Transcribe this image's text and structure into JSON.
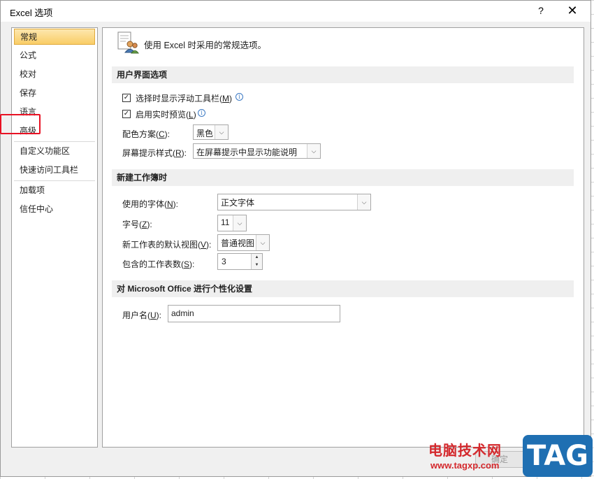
{
  "window": {
    "title": "Excel 选项",
    "help_label": "?",
    "close_label": "✕"
  },
  "nav": {
    "items": [
      {
        "label": "常规",
        "selected": true
      },
      {
        "label": "公式"
      },
      {
        "label": "校对"
      },
      {
        "label": "保存"
      },
      {
        "label": "语言"
      },
      {
        "label": "高级"
      },
      {
        "label": "自定义功能区"
      },
      {
        "label": "快速访问工具栏"
      },
      {
        "label": "加载项"
      },
      {
        "label": "信任中心"
      }
    ]
  },
  "header": {
    "text": "使用 Excel 时采用的常规选项。"
  },
  "ui_section": {
    "title": "用户界面选项",
    "show_mini_toolbar": {
      "label_pre": "选择时显示浮动工具栏(",
      "key": "M",
      "label_post": ")",
      "checked": true
    },
    "live_preview": {
      "label_pre": "启用实时预览(",
      "key": "L",
      "label_post": ")",
      "checked": true
    },
    "color_scheme": {
      "label_pre": "配色方案(",
      "key": "C",
      "label_post": "):",
      "value": "黑色"
    },
    "screentip_style": {
      "label_pre": "屏幕提示样式(",
      "key": "R",
      "label_post": "):",
      "value": "在屏幕提示中显示功能说明"
    }
  },
  "workbook_section": {
    "title": "新建工作簿时",
    "font": {
      "label_pre": "使用的字体(",
      "key": "N",
      "label_post": "):",
      "value": "正文字体"
    },
    "font_size": {
      "label_pre": "字号(",
      "key": "Z",
      "label_post": "):",
      "value": "11"
    },
    "default_view": {
      "label_pre": "新工作表的默认视图(",
      "key": "V",
      "label_post": "):",
      "value": "普通视图"
    },
    "sheet_count": {
      "label_pre": "包含的工作表数(",
      "key": "S",
      "label_post": "):",
      "value": "3"
    }
  },
  "personalize_section": {
    "title": "对 Microsoft Office 进行个性化设置",
    "username": {
      "label_pre": "用户名(",
      "key": "U",
      "label_post": "):",
      "value": "admin"
    }
  },
  "footer": {
    "ok_label": "确定"
  },
  "watermark": {
    "site_name": "电脑技术网",
    "url": "www.tagxp.com",
    "badge": "TAG"
  },
  "colors": {
    "nav_selected": "#fcd779",
    "highlight_box": "#e81123",
    "watermark_red": "#d4292d",
    "watermark_blue": "#1f6fb2"
  }
}
